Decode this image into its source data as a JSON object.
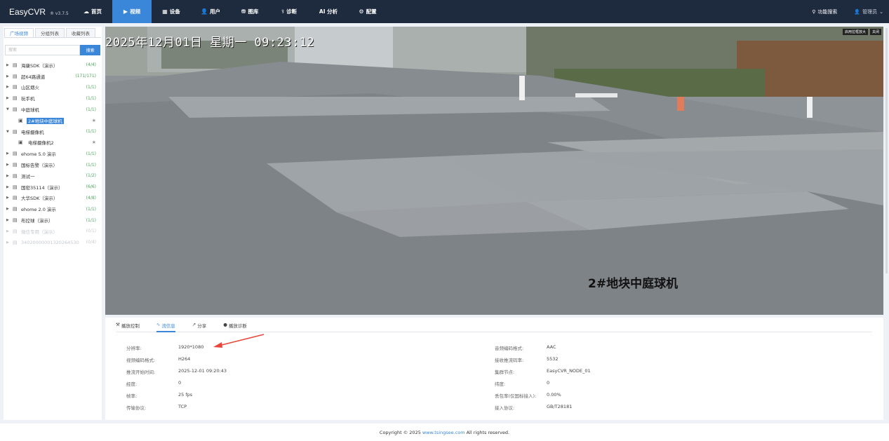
{
  "header": {
    "brand": "EasyCVR",
    "version": "® v3.7.5",
    "nav": [
      {
        "label": "首页",
        "icon": "☁",
        "active": false
      },
      {
        "label": "视频",
        "icon": "▶",
        "active": true
      },
      {
        "label": "设备",
        "icon": "▦",
        "active": false
      },
      {
        "label": "用户",
        "icon": "👤",
        "active": false
      },
      {
        "label": "图库",
        "icon": "⛃",
        "active": false
      },
      {
        "label": "诊断",
        "icon": "⚕",
        "active": false
      },
      {
        "label": "AI 分析",
        "icon": "",
        "active": false
      },
      {
        "label": "配置",
        "icon": "⚙",
        "active": false
      }
    ],
    "search_label": "功能搜索",
    "user_label": "管理员"
  },
  "sidebar": {
    "tabs": [
      "广场视频",
      "分组列表",
      "收藏列表"
    ],
    "search_placeholder": "搜索",
    "search_button": "搜索",
    "tree": [
      {
        "label": "海康SDK（演示）",
        "count": "(4/4)",
        "expanded": false
      },
      {
        "label": "超64路通道",
        "count": "(171/171)",
        "expanded": false
      },
      {
        "label": "山区烟火",
        "count": "(1/1)",
        "expanded": false
      },
      {
        "label": "玩手机",
        "count": "(1/1)",
        "expanded": false
      },
      {
        "label": "中庭球机",
        "count": "(1/1)",
        "expanded": true
      },
      {
        "label": "2#地块中庭球机",
        "child": true,
        "selected": true
      },
      {
        "label": "电梯摄像机",
        "count": "(1/1)",
        "expanded": true
      },
      {
        "label": "电梯摄像机2",
        "child": true
      },
      {
        "label": "ehome 5.0 演示",
        "count": "(1/1)",
        "expanded": false
      },
      {
        "label": "国标告警（演示）",
        "count": "(1/1)",
        "expanded": false
      },
      {
        "label": "测试一",
        "count": "(1/2)",
        "expanded": false
      },
      {
        "label": "国密35114（演示）",
        "count": "(6/6)",
        "expanded": false
      },
      {
        "label": "大华SDK（演示）",
        "count": "(4/8)",
        "expanded": false
      },
      {
        "label": "ehome 2.0 演示",
        "count": "(1/1)",
        "expanded": false
      },
      {
        "label": "布控球（演示）",
        "count": "(1/1)",
        "expanded": false
      },
      {
        "label": "微信专用（演示）",
        "count": "(0/1)",
        "disabled": true
      },
      {
        "label": "34020000001320264530",
        "count": "(0/4)",
        "disabled": true
      }
    ]
  },
  "video": {
    "osd_time": "2025年12月01日 星期一 09:23:12",
    "osd_name": "2#地块中庭球机",
    "btn_zoom": "启用拉框放大",
    "btn_close": "关闭"
  },
  "panel": {
    "tabs": [
      {
        "label": "播放控制",
        "icon": "⚒",
        "active": false
      },
      {
        "label": "流信息",
        "icon": "∿",
        "active": true
      },
      {
        "label": "分享",
        "icon": "↗",
        "active": false
      },
      {
        "label": "播放诊断",
        "icon": "●",
        "active": false
      }
    ],
    "left": [
      {
        "label": "分辨率:",
        "value": "1920*1080"
      },
      {
        "label": "视频编码格式:",
        "value": "H264"
      },
      {
        "label": "推流开始时间:",
        "value": "2025-12-01 09:20:43"
      },
      {
        "label": "经度:",
        "value": "0"
      },
      {
        "label": "帧率:",
        "value": "25 fps"
      },
      {
        "label": "传输协议:",
        "value": "TCP"
      }
    ],
    "right": [
      {
        "label": "音频编码格式:",
        "value": "AAC"
      },
      {
        "label": "接收推流码率:",
        "value": "5532"
      },
      {
        "label": "集群节点:",
        "value": "EasyCVR_NODE_01"
      },
      {
        "label": "纬度:",
        "value": "0"
      },
      {
        "label": "丢包率(仅国标接入):",
        "value": "0.00%"
      },
      {
        "label": "接入协议:",
        "value": "GB/T28181"
      }
    ]
  },
  "footer": {
    "prefix": "Copyright © 2025",
    "link": "www.tsingsee.com",
    "suffix": "All rights reserved."
  },
  "colors": {
    "accent": "#3a86d8",
    "header": "#1e2a3d",
    "arrow": "#e8463a"
  }
}
